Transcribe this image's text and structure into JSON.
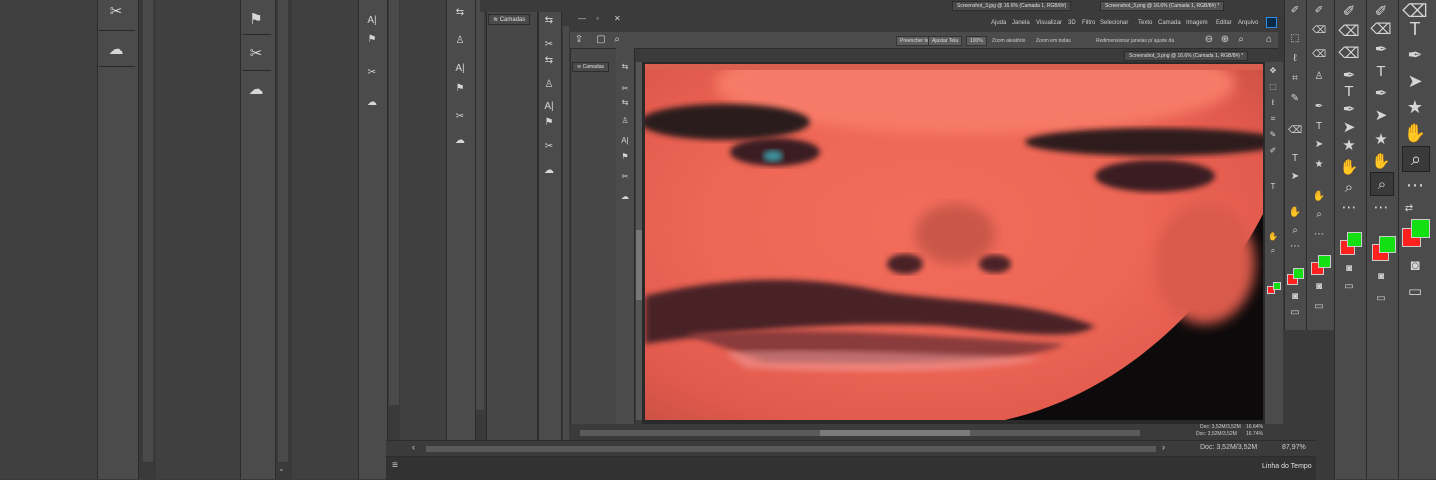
{
  "colors": {
    "bg": "#3a3a3a",
    "panel": "#535353",
    "accent": "#2d8ceb",
    "fg_swatch": "#ff2020",
    "bg_swatch": "#13e013",
    "photo": "#ee6655"
  },
  "left_strip": {
    "icons": [
      "scissors-icon",
      "creative-cloud-icon",
      "flag-icon",
      "scissors-icon",
      "creative-cloud-icon",
      "text-icon",
      "flag-icon",
      "scissors-icon",
      "creative-cloud-icon"
    ]
  },
  "panel_mid": {
    "layers_label": "Camadas",
    "icons": [
      "transform-icon",
      "scissors-icon",
      "stamp-icon",
      "text-icon",
      "flag-icon",
      "scissors-icon",
      "creative-cloud-icon"
    ]
  },
  "document": {
    "tab_title": "Screenshot_3.png @ 16.6% (Camada 1, RGB/8#) *",
    "tab_title2": "Screenshot_3.jpg @ 16.6% (Camada 1, RGB/8#)",
    "inner_tab": "Screenshot_3.png @ 16.6% (Camada 1, RGB/8#) *"
  },
  "menu": {
    "items": [
      "Arquivo",
      "Editar",
      "Imagem",
      "Camada",
      "Texto",
      "Selecionar",
      "Filtro",
      "3D",
      "Visualizar",
      "Janela",
      "Ajuda"
    ]
  },
  "options_bar": {
    "zoom_all": "Zoom em todas",
    "resize": "Redimensionar janelas p/ ajuste da",
    "scrubby": "Zoom aleatório",
    "pct": "100%",
    "fit": "Ajustar Tela",
    "fill": "Preencher tela"
  },
  "status": {
    "zoom": "16.74%",
    "doc": "Doc: 3,52M/3,52M",
    "zoom_outer": "87,97%",
    "doc_outer": "Doc: 3,52M/3,52M",
    "zoom_inner": "16.64%",
    "doc_inner": "Doc: 3,52M/3,52M"
  },
  "timeline": {
    "label": "Linha do Tempo"
  },
  "tools_right": {
    "icons": [
      "brush-icon",
      "eraser-icon",
      "pen-icon",
      "text-icon",
      "path-select-icon",
      "shape-icon",
      "hand-icon",
      "zoom-icon",
      "more-icon"
    ]
  }
}
